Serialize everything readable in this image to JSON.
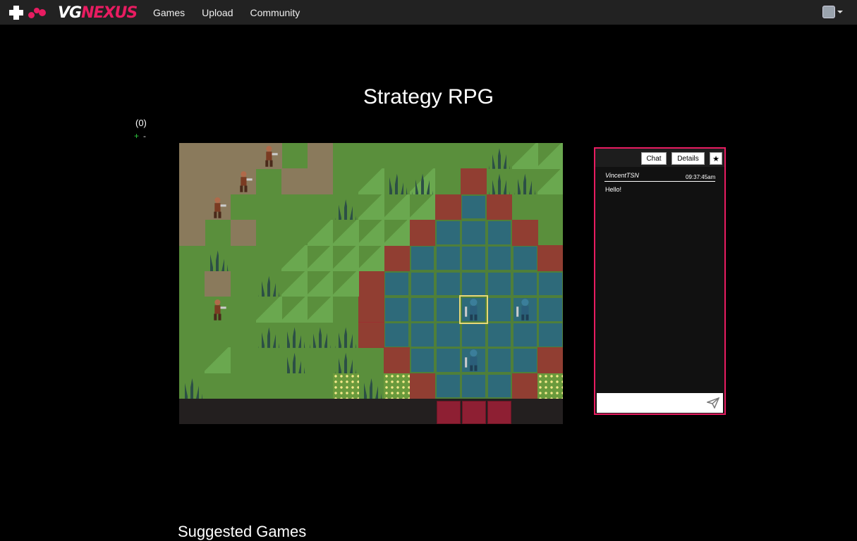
{
  "nav": {
    "logo_vg": "VG",
    "logo_nexus": "NEXUS",
    "links": [
      "Games",
      "Upload",
      "Community"
    ]
  },
  "page": {
    "title": "Strategy RPG",
    "rating_count": "(0)",
    "vote_up": "+",
    "vote_down": "-"
  },
  "game": {
    "palette": {
      "grass": "#5a8f3c",
      "dirt": "#8a7a5c",
      "water": "#2e6a7a",
      "red": "#9b3030",
      "hill": "#6aa84f",
      "tree": "#2c4f46"
    }
  },
  "chat": {
    "tab_chat": "Chat",
    "tab_details": "Details",
    "star_icon": "★",
    "messages": [
      {
        "user": "VincentTSN",
        "time": "09:37:45am",
        "text": "Hello!"
      }
    ],
    "input_value": ""
  },
  "footer": {
    "suggested_heading": "Suggested Games"
  }
}
